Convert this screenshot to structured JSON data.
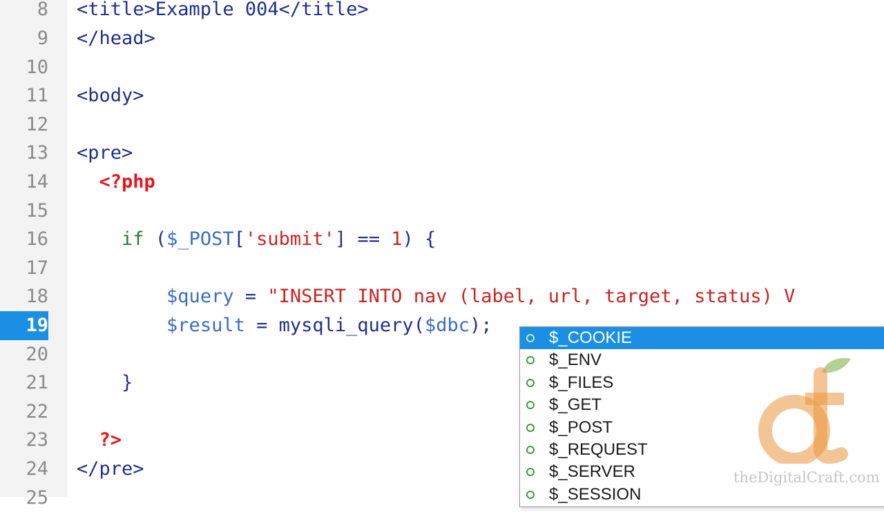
{
  "editor": {
    "lines": [
      {
        "num": "8",
        "tokens": [
          {
            "c": "t-tag",
            "t": "<title>Example 004</title>"
          }
        ]
      },
      {
        "num": "9",
        "tokens": [
          {
            "c": "t-tag",
            "t": "</head>"
          }
        ]
      },
      {
        "num": "10",
        "tokens": []
      },
      {
        "num": "11",
        "tokens": [
          {
            "c": "t-tag",
            "t": "<body>"
          }
        ]
      },
      {
        "num": "12",
        "tokens": []
      },
      {
        "num": "13",
        "tokens": [
          {
            "c": "t-tag",
            "t": "<pre>"
          }
        ]
      },
      {
        "num": "14",
        "tokens": [
          {
            "c": "",
            "t": "  "
          },
          {
            "c": "t-php",
            "t": "<?php"
          }
        ]
      },
      {
        "num": "15",
        "tokens": []
      },
      {
        "num": "16",
        "tokens": [
          {
            "c": "",
            "t": "    "
          },
          {
            "c": "t-kw",
            "t": "if"
          },
          {
            "c": "",
            "t": " "
          },
          {
            "c": "t-pun",
            "t": "("
          },
          {
            "c": "t-var",
            "t": "$_POST"
          },
          {
            "c": "t-pun",
            "t": "["
          },
          {
            "c": "t-str",
            "t": "'submit'"
          },
          {
            "c": "t-pun",
            "t": "] == "
          },
          {
            "c": "t-num",
            "t": "1"
          },
          {
            "c": "t-pun",
            "t": ") {"
          }
        ]
      },
      {
        "num": "17",
        "tokens": []
      },
      {
        "num": "18",
        "tokens": [
          {
            "c": "",
            "t": "        "
          },
          {
            "c": "t-var",
            "t": "$query"
          },
          {
            "c": "t-pun",
            "t": " = "
          },
          {
            "c": "t-str",
            "t": "\"INSERT INTO nav (label, url, target, status) V"
          }
        ]
      },
      {
        "num": "19",
        "current": true,
        "tokens": [
          {
            "c": "",
            "t": "        "
          },
          {
            "c": "t-var",
            "t": "$result"
          },
          {
            "c": "t-pun",
            "t": " = "
          },
          {
            "c": "t-fn",
            "t": "mysqli_query"
          },
          {
            "c": "t-pun",
            "t": "("
          },
          {
            "c": "t-var",
            "t": "$dbc"
          },
          {
            "c": "t-pun",
            "t": ");"
          }
        ]
      },
      {
        "num": "20",
        "tokens": []
      },
      {
        "num": "21",
        "tokens": [
          {
            "c": "",
            "t": "    "
          },
          {
            "c": "t-pun",
            "t": "}"
          }
        ]
      },
      {
        "num": "22",
        "tokens": []
      },
      {
        "num": "23",
        "tokens": [
          {
            "c": "",
            "t": "  "
          },
          {
            "c": "t-php",
            "t": "?>"
          }
        ]
      },
      {
        "num": "24",
        "tokens": [
          {
            "c": "t-tag",
            "t": "</pre>"
          }
        ]
      },
      {
        "num": "25",
        "tokens": []
      }
    ]
  },
  "autocomplete": {
    "items": [
      "$_COOKIE",
      "$_ENV",
      "$_FILES",
      "$_GET",
      "$_POST",
      "$_REQUEST",
      "$_SERVER",
      "$_SESSION"
    ],
    "selected_index": 0
  },
  "watermark": {
    "text": "theDigitalCraft.com",
    "logo_icon": "dc-apple-logo-icon"
  },
  "colors": {
    "accent": "#1a8fe3",
    "tag": "#1f2f8c",
    "php": "#e8141c",
    "keyword": "#2a7a2a",
    "variable": "#3a6cc8",
    "string": "#cc2222"
  }
}
